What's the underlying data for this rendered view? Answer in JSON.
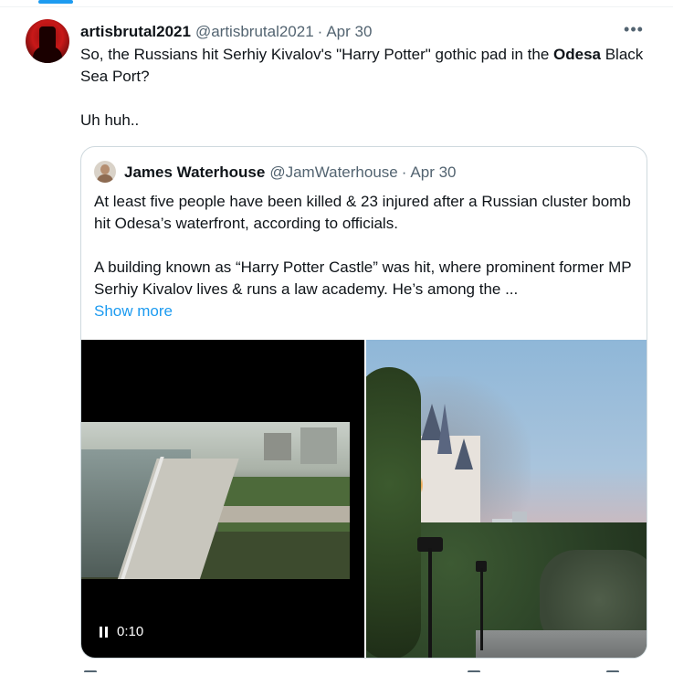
{
  "tweet": {
    "author_name": "artisbrutal2021",
    "author_handle": "@artisbrutal2021",
    "separator": "·",
    "date": "Apr 30",
    "more_icon": "more-horizontal-icon",
    "text_part1": "So, the Russians hit Serhiy Kivalov's \"Harry Potter\" gothic  pad in the ",
    "text_bold": "Odesa",
    "text_part2": " Black Sea Port?",
    "text_line3": "Uh huh.."
  },
  "quoted_tweet": {
    "author_name": "James Waterhouse",
    "author_handle": "@JamWaterhouse",
    "separator": "·",
    "date": "Apr 30",
    "paragraph1": "At least five people have been killed & 23 injured after a Russian cluster bomb hit Odesa’s waterfront, according to officials.",
    "paragraph2": "A building known as “Harry Potter Castle” was hit, where prominent former MP Serhiy Kivalov lives & runs a law academy. He’s among the ...",
    "show_more": "Show more",
    "media": {
      "video_time": "0:10",
      "video_control_icon": "pause-icon"
    }
  },
  "colors": {
    "accent": "#1d9bf0",
    "text_primary": "#0f1419",
    "text_secondary": "#536471",
    "border": "#cfd9de"
  }
}
